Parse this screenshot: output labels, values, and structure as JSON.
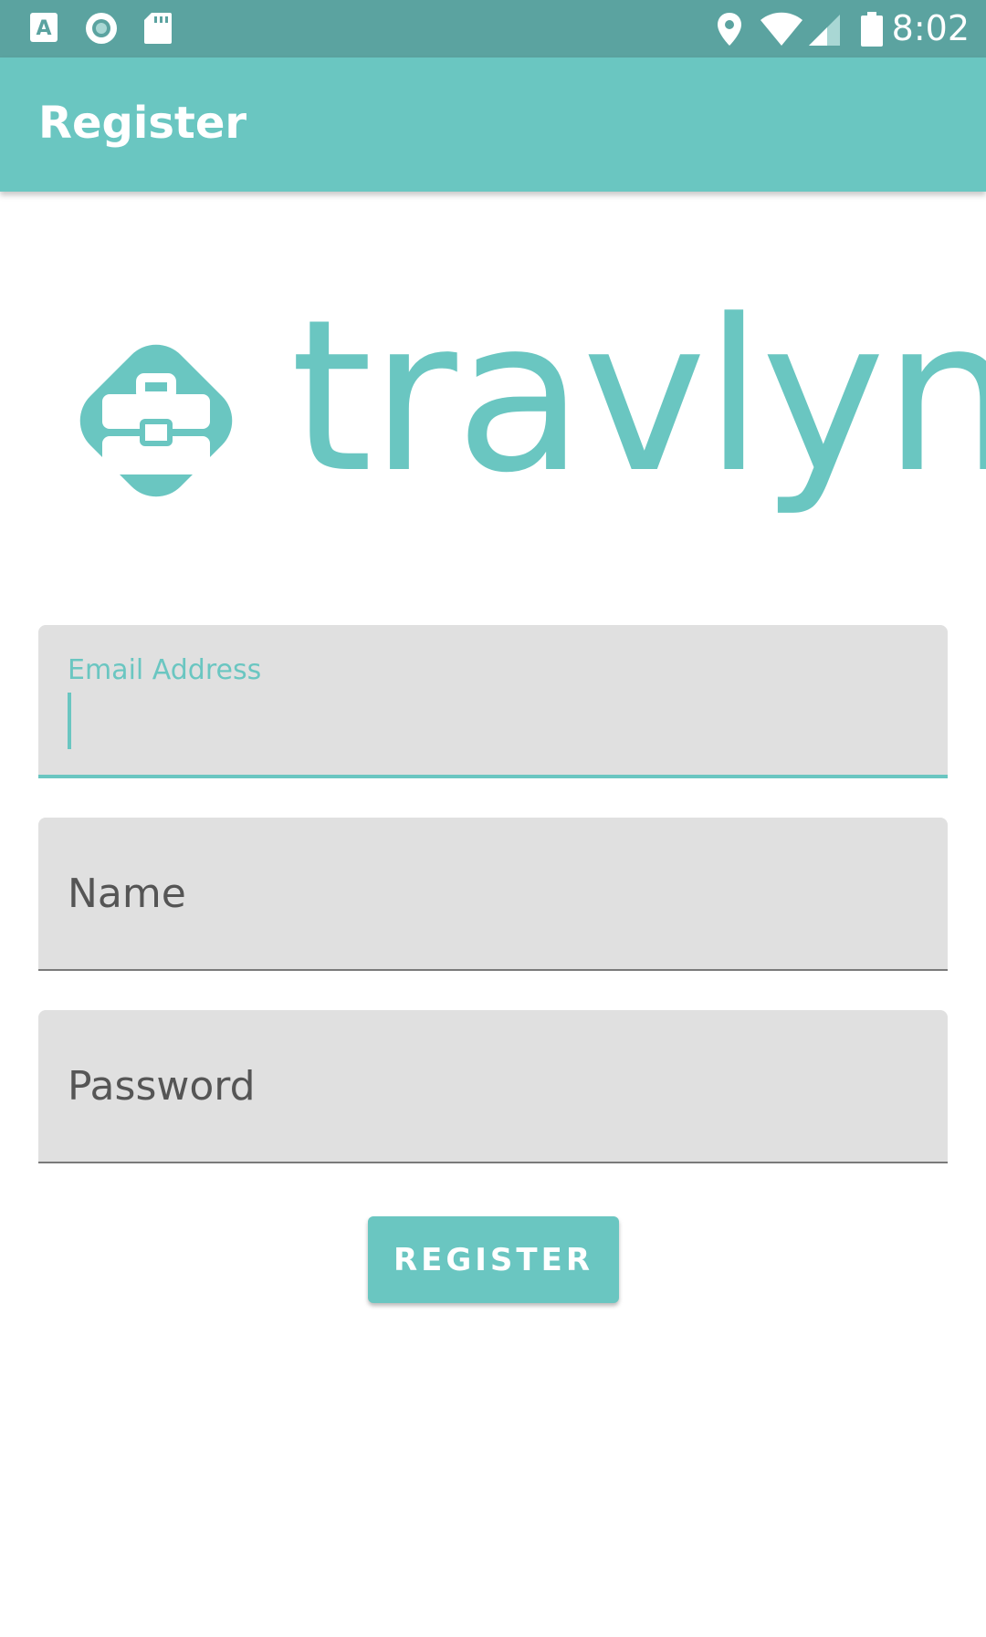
{
  "status_bar": {
    "time": "8:02",
    "icons": [
      "a-notification-icon",
      "circle-notification-icon",
      "sd-card-icon",
      "location-icon",
      "wifi-icon",
      "signal-icon",
      "battery-icon"
    ]
  },
  "app_bar": {
    "title": "Register"
  },
  "logo": {
    "text": "travlyn",
    "icon": "briefcase-icon"
  },
  "form": {
    "email": {
      "label": "Email Address",
      "value": ""
    },
    "name": {
      "placeholder": "Name",
      "value": ""
    },
    "password": {
      "placeholder": "Password",
      "value": ""
    },
    "register_label": "REGISTER"
  },
  "colors": {
    "status_bar": "#5ba3a0",
    "primary": "#6ac6c1",
    "field_bg": "#e0e0e0",
    "field_text": "#555555"
  }
}
